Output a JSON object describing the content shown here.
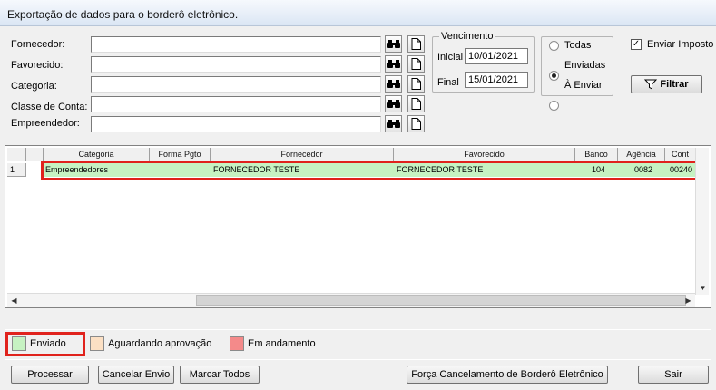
{
  "window": {
    "title": "Exportação de dados para o borderô eletrônico."
  },
  "filters": {
    "fornecedor_label": "Fornecedor:",
    "favorecido_label": "Favorecido:",
    "categoria_label": "Categoria:",
    "classe_label": "Classe de Conta:",
    "empreendedor_label": "Empreendedor:"
  },
  "vencimento": {
    "title": "Vencimento",
    "inicial_label": "Inicial",
    "inicial_value": "10/01/2021",
    "final_label": "Final",
    "final_value": "15/01/2021"
  },
  "status_options": {
    "todas": "Todas",
    "enviadas": "Enviadas",
    "a_enviar": "À Enviar",
    "selected": "Enviadas"
  },
  "enviar_imposto": {
    "label": "Enviar Imposto",
    "checked": true
  },
  "filtrar_label": "Filtrar",
  "grid": {
    "columns": [
      "Categoria",
      "Forma Pgto",
      "Fornecedor",
      "Favorecido",
      "Banco",
      "Agência",
      "Cont"
    ],
    "rows": [
      {
        "num": "1",
        "categoria": "Empreendedores",
        "forma_pgto": "",
        "fornecedor": "FORNECEDOR TESTE",
        "favorecido": "FORNECEDOR TESTE",
        "banco": "104",
        "agencia": "0082",
        "conta": "00240"
      }
    ]
  },
  "legend": {
    "enviado": {
      "label": "Enviado",
      "color": "#c6f2c2"
    },
    "aguardando": {
      "label": "Aguardando aprovação",
      "color": "#fce0c4"
    },
    "andamento": {
      "label": "Em andamento",
      "color": "#f48a8a"
    }
  },
  "buttons": {
    "processar": "Processar",
    "cancelar_envio": "Cancelar Envio",
    "marcar_todos": "Marcar Todos",
    "forca_cancelamento": "Força Cancelamento de Borderô Eletrônico",
    "sair": "Sair"
  },
  "colors": {
    "highlight_red": "#e0221c",
    "titlebar": "#dbe6f4"
  }
}
